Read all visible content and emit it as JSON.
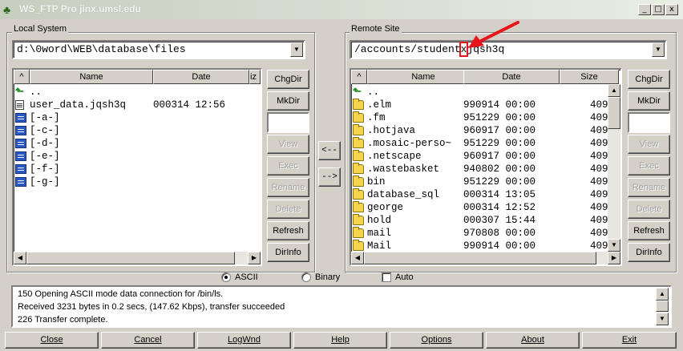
{
  "window": {
    "title": "WS_FTP Pro jinx.umsl.edu",
    "controls": {
      "minimize": "_",
      "maximize": "□",
      "close": "x"
    }
  },
  "local": {
    "group_label": "Local System",
    "path": "d:\\0word\\WEB\\database\\files",
    "columns": {
      "sort": "^",
      "name": "Name",
      "date": "Date",
      "size": "iz"
    },
    "rows": [
      {
        "icon": "up-folder-icon",
        "name": ".."
      },
      {
        "icon": "file-icon",
        "name": "user_data.jqsh3q",
        "date": "000314 12:56"
      },
      {
        "icon": "drive-icon",
        "name": "[-a-]"
      },
      {
        "icon": "drive-icon",
        "name": "[-c-]"
      },
      {
        "icon": "drive-icon",
        "name": "[-d-]"
      },
      {
        "icon": "drive-icon",
        "name": "[-e-]"
      },
      {
        "icon": "drive-icon",
        "name": "[-f-]"
      },
      {
        "icon": "drive-icon",
        "name": "[-g-]"
      }
    ],
    "buttons": {
      "chgdir": "ChgDir",
      "mkdir": "MkDir",
      "view": "View",
      "exec": "Exec",
      "rename": "Rename",
      "delete": "Delete",
      "refresh": "Refresh",
      "dirinfo": "DirInfo"
    }
  },
  "transfer": {
    "to_local": "<--",
    "to_remote": "-->"
  },
  "remote": {
    "group_label": "Remote Site",
    "path_prefix": "/accounts/student",
    "path_highlight": "x",
    "path_suffix": "jqsh3q",
    "columns": {
      "sort": "^",
      "name": "Name",
      "date": "Date",
      "size": "Size"
    },
    "rows": [
      {
        "icon": "up-folder-icon",
        "name": "..",
        "date": "",
        "size": ""
      },
      {
        "icon": "folder-icon",
        "name": ".elm",
        "date": "990914 00:00",
        "size": "409"
      },
      {
        "icon": "folder-icon",
        "name": ".fm",
        "date": "951229 00:00",
        "size": "409"
      },
      {
        "icon": "folder-icon",
        "name": ".hotjava",
        "date": "960917 00:00",
        "size": "409"
      },
      {
        "icon": "folder-icon",
        "name": ".mosaic-perso~",
        "date": "951229 00:00",
        "size": "409"
      },
      {
        "icon": "folder-icon",
        "name": ".netscape",
        "date": "960917 00:00",
        "size": "409"
      },
      {
        "icon": "folder-icon",
        "name": ".wastebasket",
        "date": "940802 00:00",
        "size": "409"
      },
      {
        "icon": "folder-icon",
        "name": "bin",
        "date": "951229 00:00",
        "size": "409"
      },
      {
        "icon": "folder-icon",
        "name": "database_sql",
        "date": "000314 13:05",
        "size": "409"
      },
      {
        "icon": "folder-icon",
        "name": "george",
        "date": "000314 12:52",
        "size": "409"
      },
      {
        "icon": "folder-icon",
        "name": "hold",
        "date": "000307 15:44",
        "size": "409"
      },
      {
        "icon": "folder-icon",
        "name": "mail",
        "date": "970808 00:00",
        "size": "409"
      },
      {
        "icon": "folder-icon",
        "name": "Mail",
        "date": "990914 00:00",
        "size": "409"
      }
    ],
    "buttons": {
      "chgdir": "ChgDir",
      "mkdir": "MkDir",
      "view": "View",
      "exec": "Exec",
      "rename": "Rename",
      "delete": "Delete",
      "refresh": "Refresh",
      "dirinfo": "DirInfo"
    }
  },
  "mode": {
    "ascii": "ASCII",
    "binary": "Binary",
    "auto": "Auto",
    "selected": "ascii",
    "auto_checked": false
  },
  "log": {
    "lines": [
      "150 Opening ASCII mode data connection for /bin/ls.",
      "Received 3231 bytes in 0.2 secs, (147.62 Kbps), transfer succeeded",
      "226 Transfer complete."
    ]
  },
  "bottom_buttons": {
    "close": "Close",
    "cancel": "Cancel",
    "logwnd": "LogWnd",
    "help": "Help",
    "options": "Options",
    "about": "About",
    "exit": "Exit"
  },
  "colors": {
    "annotation_arrow": "#e8141c",
    "face": "#d4d0c8"
  }
}
